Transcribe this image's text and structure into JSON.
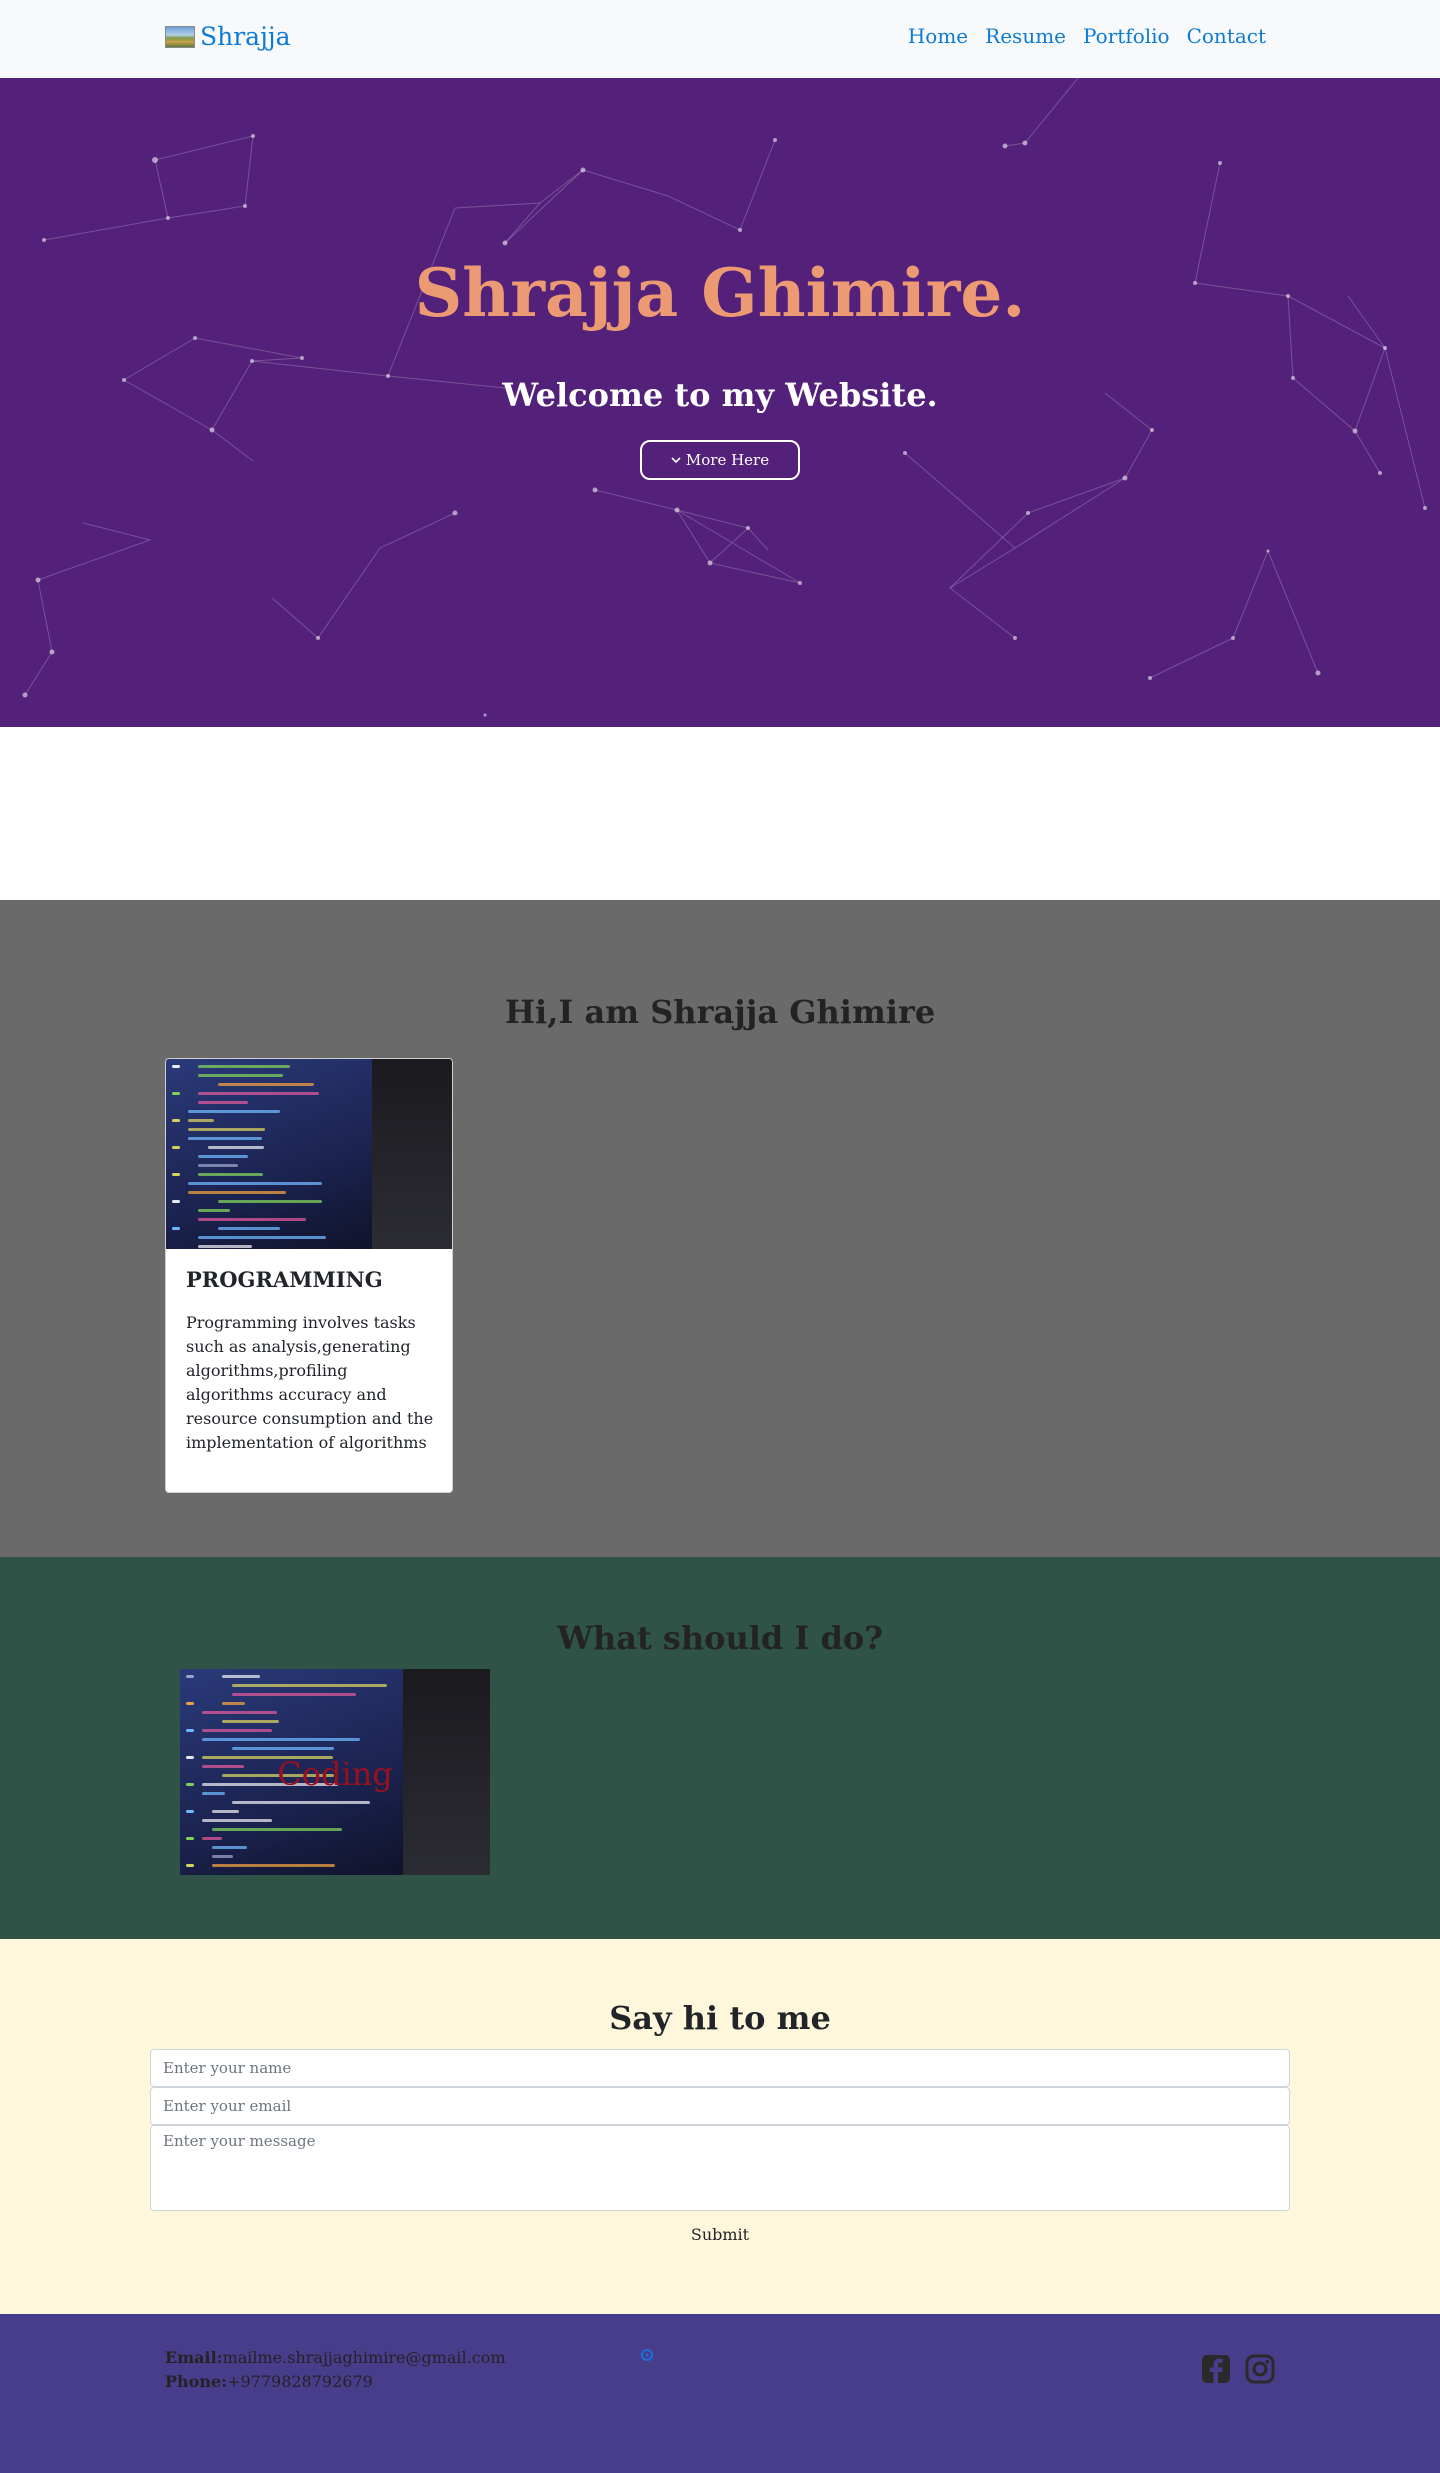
{
  "nav": {
    "brand": "Shrajja",
    "links": [
      "Home",
      "Resume",
      "Portfolio",
      "Contact"
    ]
  },
  "hero": {
    "title": "Shrajja Ghimire.",
    "subtitle": "Welcome to my Website.",
    "button_label": "More Here",
    "button_icon": "chevron-down-icon"
  },
  "about": {
    "title": "Hi,I am Shrajja Ghimire",
    "card": {
      "title": "PROGRAMMING",
      "text": "Programming involves tasks such as analysis,generating algorithms,profiling algorithms accuracy and resource consumption and the implementation of algorithms"
    }
  },
  "services": {
    "title": "What should I do?",
    "tile_label": "Coding"
  },
  "contact": {
    "title": "Say hi to me",
    "name_placeholder": "Enter your name",
    "email_placeholder": "Enter your email",
    "message_placeholder": "Enter your message",
    "submit_label": "Submit"
  },
  "footer": {
    "email_label": "Email:",
    "email": "mailme.shrajjaghimire@gmail.com",
    "phone_label": "Phone:",
    "phone": "+9779828792679",
    "social_icons": [
      "facebook-icon",
      "instagram-icon"
    ]
  },
  "colors": {
    "nav_link": "#0d7bd6",
    "hero_bg": "#54217a",
    "hero_title": "#ec9a73",
    "about_bg": "#6a6a6a",
    "services_bg": "#2f5347",
    "service_label": "#9b1020",
    "contact_bg": "#fff7dc",
    "footer_bg": "#483d8b"
  }
}
